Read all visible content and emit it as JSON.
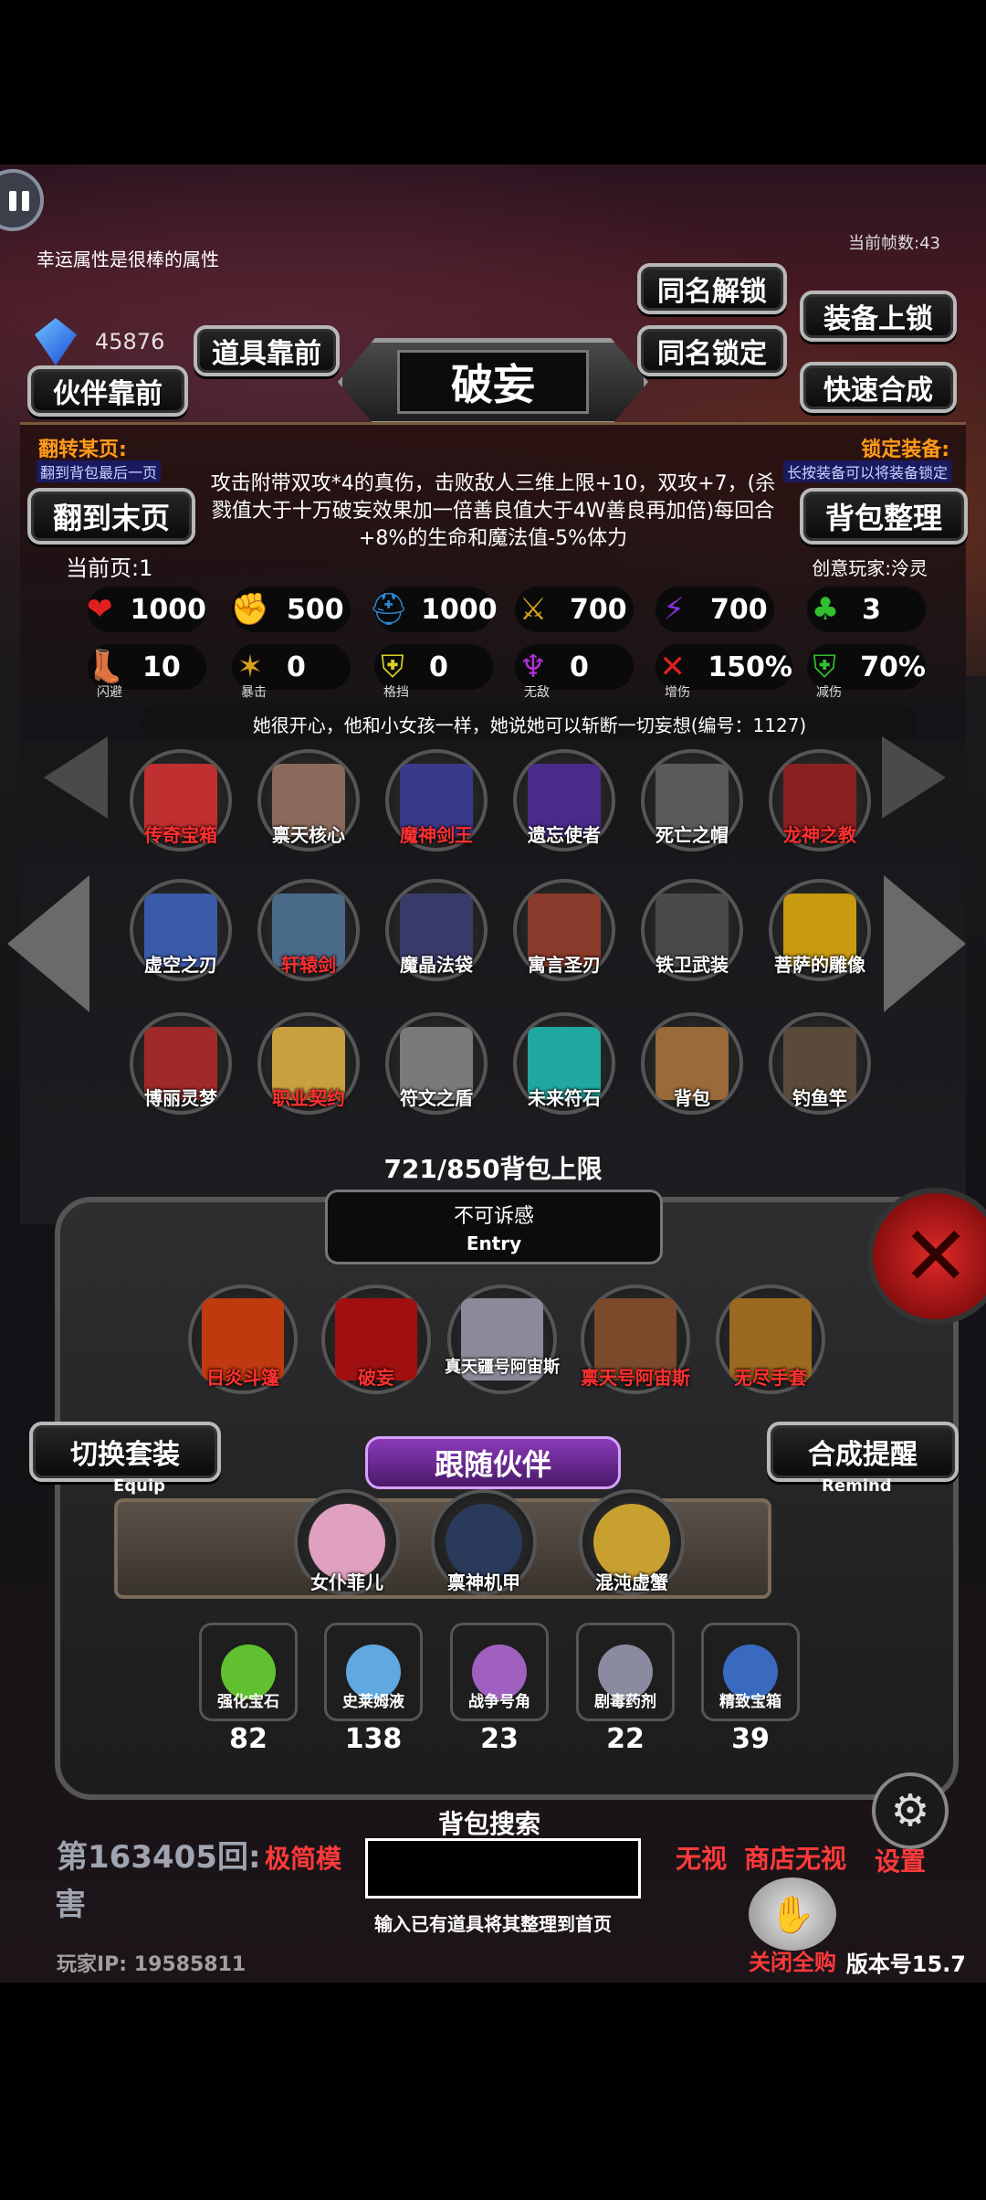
{
  "hud": {
    "fps": "当前帧数:43",
    "hint": "幸运属性是很棒的属性",
    "gem_count": "45876"
  },
  "buttons": {
    "items_front": "道具靠前",
    "partner_front": "伙伴靠前",
    "same_name_unlock": "同名解锁",
    "same_name_lock": "同名锁定",
    "equip_lock": "装备上锁",
    "quick_merge": "快速合成",
    "last_page": "翻到末页",
    "sort_bag": "背包整理"
  },
  "title": "破妄",
  "flip": {
    "title": "翻转某页:",
    "sub": "翻到背包最后一页"
  },
  "lock_equip": {
    "title": "锁定装备:",
    "sub": "长按装备可以将装备锁定"
  },
  "description": "攻击附带双攻*4的真伤，击败敌人三维上限+10，双攻+7，(杀戮值大于十万破妄效果加一倍善良值大于4W善良再加倍)每回合+8%的生命和魔法值-5%体力",
  "current_page": "当前页:1",
  "creator": "创意玩家:泠灵",
  "stats_row1": [
    {
      "icon": "heart-icon",
      "glyph": "❤",
      "color": "#e02020",
      "value": "1000"
    },
    {
      "icon": "muscle-icon",
      "glyph": "✊",
      "color": "#e0c020",
      "value": "500"
    },
    {
      "icon": "helmet-icon",
      "glyph": "⛑",
      "color": "#2a8ad8",
      "value": "1000"
    },
    {
      "icon": "sword-icon",
      "glyph": "⚔",
      "color": "#d8a020",
      "value": "700"
    },
    {
      "icon": "lightning-icon",
      "glyph": "⚡",
      "color": "#8a30d8",
      "value": "700"
    },
    {
      "icon": "clover-icon",
      "glyph": "♣",
      "color": "#30c030",
      "value": "3"
    }
  ],
  "stats_row2": [
    {
      "icon": "boot-icon",
      "glyph": "👢",
      "color": "#2a8ad8",
      "value": "10",
      "caption": "闪避"
    },
    {
      "icon": "crit-icon",
      "glyph": "✶",
      "color": "#d8a020",
      "value": "0",
      "caption": "暴击"
    },
    {
      "icon": "shield-icon",
      "glyph": "⛨",
      "color": "#d8d020",
      "value": "0",
      "caption": "格挡"
    },
    {
      "icon": "wings-icon",
      "glyph": "♆",
      "color": "#b030d8",
      "value": "0",
      "caption": "无敌"
    },
    {
      "icon": "swords-crossed-icon",
      "glyph": "✕",
      "color": "#e02020",
      "value": "150%",
      "caption": "增伤"
    },
    {
      "icon": "green-shield-icon",
      "glyph": "⛨",
      "color": "#30c030",
      "value": "70%",
      "caption": "减伤"
    }
  ],
  "lore": "她很开心，他和小女孩一样，她说她可以斩断一切妄想(编号：1127)",
  "inventory": [
    {
      "label": "传奇宝箱",
      "tone": "red",
      "color": "#c03030"
    },
    {
      "label": "禀天核心",
      "tone": "white",
      "color": "#8a6a5a"
    },
    {
      "label": "魔神剑王",
      "tone": "red",
      "color": "#3a3a8a"
    },
    {
      "label": "遗忘使者",
      "tone": "white",
      "color": "#4a2a8a"
    },
    {
      "label": "死亡之帽",
      "tone": "white",
      "color": "#5a5a5a"
    },
    {
      "label": "龙神之教",
      "tone": "red",
      "color": "#8a2020"
    },
    {
      "label": "虚空之刃",
      "tone": "white",
      "color": "#3a5aaa"
    },
    {
      "label": "轩辕剑",
      "tone": "red",
      "color": "#4a6a8a"
    },
    {
      "label": "魔晶法袋",
      "tone": "white",
      "color": "#3a3a6a"
    },
    {
      "label": "寓言圣刃",
      "tone": "white",
      "color": "#8a3a2a"
    },
    {
      "label": "铁卫武装",
      "tone": "white",
      "color": "#4a4a4a"
    },
    {
      "label": "菩萨的雕像",
      "tone": "white",
      "color": "#c89a10"
    },
    {
      "label": "博丽灵梦",
      "tone": "white",
      "color": "#a02a2a"
    },
    {
      "label": "职业契约",
      "tone": "red",
      "color": "#c8a040"
    },
    {
      "label": "符文之盾",
      "tone": "white",
      "color": "#7a7a7a"
    },
    {
      "label": "未来符石",
      "tone": "white",
      "color": "#20a8a0"
    },
    {
      "label": "背包",
      "tone": "white",
      "color": "#9a6a3a"
    },
    {
      "label": "钓鱼竿",
      "tone": "white",
      "color": "#5a4a3a"
    }
  ],
  "capacity": "721/850背包上限",
  "entry": {
    "title": "不可诉感",
    "sub": "Entry"
  },
  "equipped": [
    {
      "label": "日炎斗篷",
      "tone": "red",
      "color": "#c03a10"
    },
    {
      "label": "破妄",
      "tone": "red",
      "color": "#a01010"
    },
    {
      "label": "真天疆号阿宙斯",
      "tone": "white",
      "color": "#8a8a9a"
    },
    {
      "label": "禀天号阿宙斯",
      "tone": "red",
      "color": "#7a4a2a"
    },
    {
      "label": "无尽手套",
      "tone": "red",
      "color": "#9a6a20"
    }
  ],
  "switch_equip": {
    "main": "切换套装",
    "sub": "Equip"
  },
  "companion_title": "跟随伙伴",
  "merge_remind": {
    "main": "合成提醒",
    "sub": "Remind"
  },
  "companions": [
    {
      "label": "女仆菲儿",
      "tone": "white",
      "color": "#e0a0c0"
    },
    {
      "label": "禀神机甲",
      "tone": "white",
      "color": "#2a3a5a"
    },
    {
      "label": "混沌虚蟹",
      "tone": "white",
      "color": "#c8a030"
    }
  ],
  "consumables": [
    {
      "name": "强化宝石",
      "count": "82",
      "color": "#60c030"
    },
    {
      "name": "史莱姆液",
      "count": "138",
      "color": "#60a8e0"
    },
    {
      "name": "战争号角",
      "count": "23",
      "color": "#a060c0"
    },
    {
      "name": "剧毒药剂",
      "count": "22",
      "color": "#8a8aa0"
    },
    {
      "name": "精致宝箱",
      "count": "39",
      "color": "#3a6ac0"
    }
  ],
  "footer": {
    "round": "第163405回:",
    "round2": "害",
    "simple": "极简模",
    "ignore": "无视",
    "shop_ignore": "商店无视",
    "settings": "设置",
    "close_buy": "关闭全购",
    "player_ip": "玩家IP:  19585811",
    "version": "版本号15.7",
    "search_title": "背包搜索",
    "search_hint": "输入已有道具将其整理到首页"
  }
}
